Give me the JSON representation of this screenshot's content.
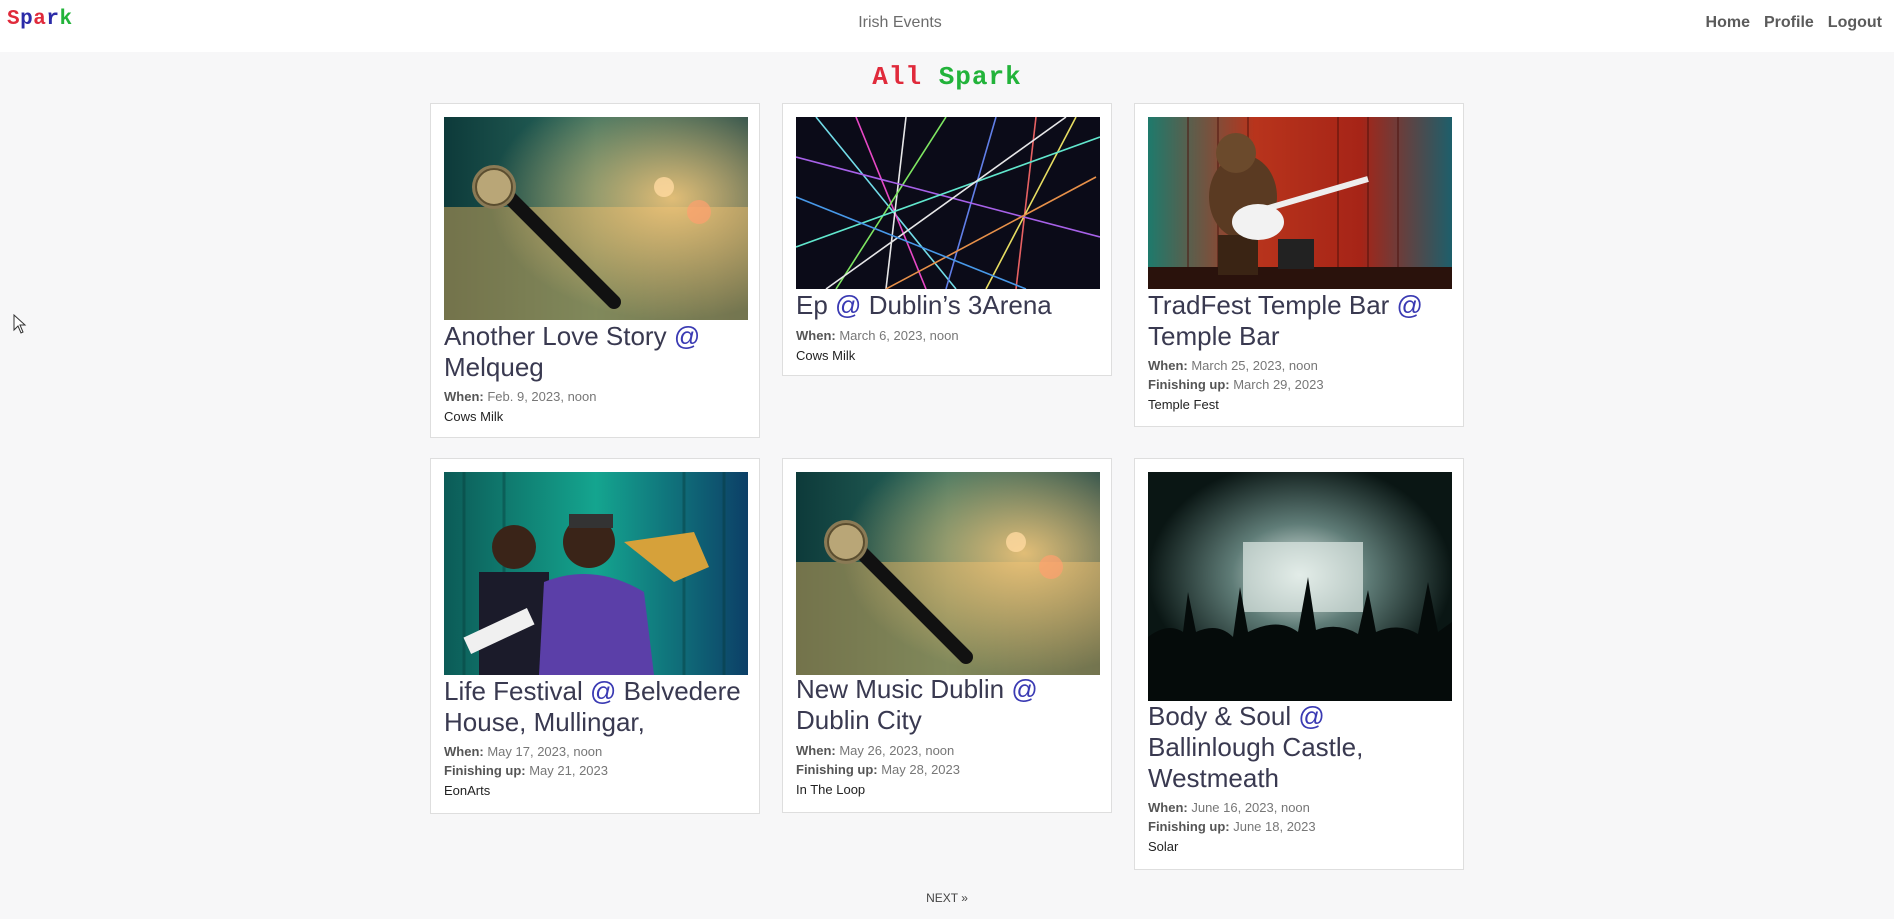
{
  "header": {
    "logo": [
      "S",
      "p",
      "a",
      "r",
      "k"
    ],
    "logo_colors": [
      "#e02a3b",
      "#2b2ba8",
      "#e02a3b",
      "#2b2ba8",
      "#22b33a"
    ],
    "center_title": "Irish Events",
    "nav": {
      "home": "Home",
      "profile": "Profile",
      "logout": "Logout"
    }
  },
  "heading": {
    "word1": "All",
    "word2": "Spark"
  },
  "events": [
    {
      "title": "Another Love Story",
      "at": "@",
      "venue": "Melqueg",
      "when_label": "When:",
      "when": "Feb. 9, 2023, noon",
      "organizer": "Cows Milk",
      "image": "microphone-image"
    },
    {
      "title": "Ep",
      "at": "@",
      "venue": "Dublin’s 3Arena",
      "when_label": "When:",
      "when": "March 6, 2023, noon",
      "organizer": "Cows Milk",
      "image": "laser-show-image"
    },
    {
      "title": "TradFest Temple Bar",
      "at": "@",
      "venue": "Temple Bar",
      "when_label": "When:",
      "when": "March 25, 2023, noon",
      "finish_label": "Finishing up:",
      "finish": "March 29, 2023",
      "organizer": "Temple Fest",
      "image": "guitar-monkey-image"
    },
    {
      "title": "Life Festival",
      "at": "@",
      "venue": "Belvedere House, Mullingar,",
      "when_label": "When:",
      "when": "May 17, 2023, noon",
      "finish_label": "Finishing up:",
      "finish": "May 21, 2023",
      "organizer": "EonArts",
      "image": "saxophone-player-image"
    },
    {
      "title": "New Music Dublin",
      "at": "@",
      "venue": "Dublin City",
      "when_label": "When:",
      "when": "May 26, 2023, noon",
      "finish_label": "Finishing up:",
      "finish": "May 28, 2023",
      "organizer": "In The Loop",
      "image": "microphone-image"
    },
    {
      "title": "Body & Soul",
      "at": "@",
      "venue": "Ballinlough Castle, Westmeath",
      "when_label": "When:",
      "when": "June 16, 2023, noon",
      "finish_label": "Finishing up:",
      "finish": "June 18, 2023",
      "organizer": "Solar",
      "image": "concert-crowd-image"
    }
  ],
  "pagination": {
    "next": "NEXT »"
  }
}
